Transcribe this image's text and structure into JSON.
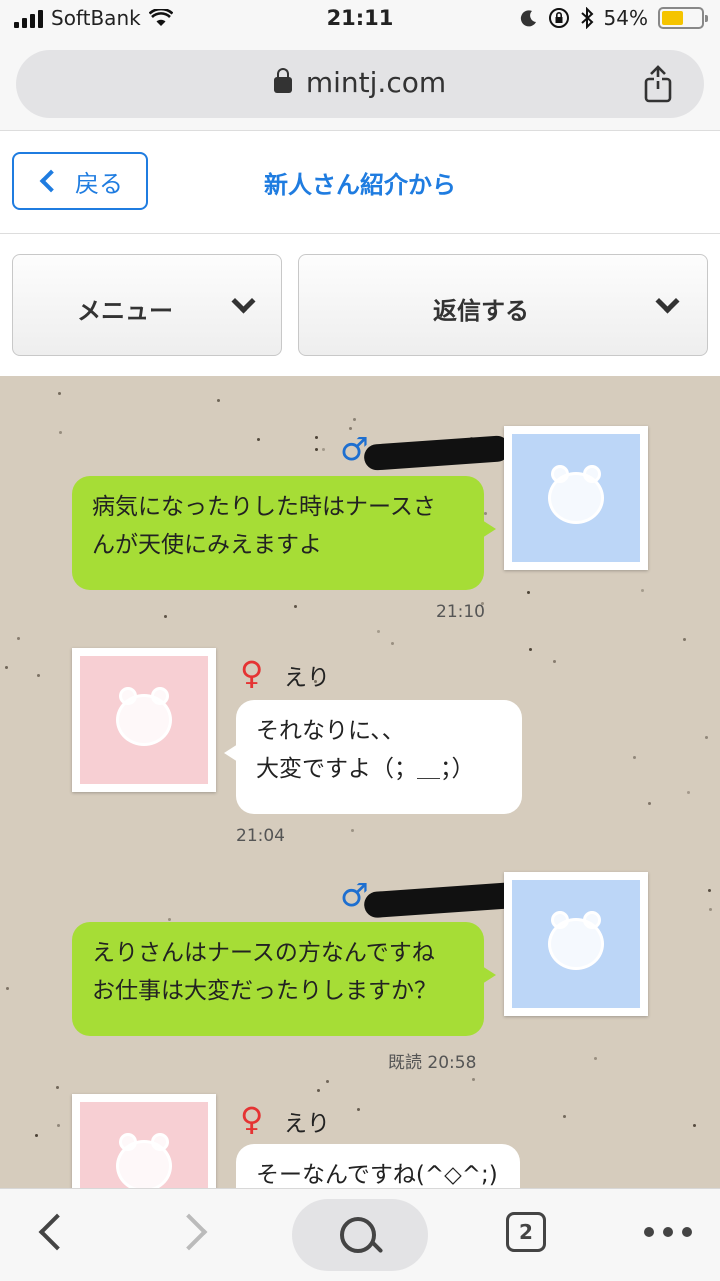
{
  "status_bar": {
    "carrier": "SoftBank",
    "time": "21:11",
    "battery": "54%",
    "battery_level": 0.54
  },
  "browser": {
    "url": "mintj.com"
  },
  "header": {
    "back_label": "戻る",
    "title": "新人さん紹介から"
  },
  "menu": {
    "menu_label": "メニュー",
    "reply_label": "返信する"
  },
  "messages": [
    {
      "side": "male",
      "text_lines": [
        "病気になったりした時はナースさ",
        "んが天使にみえますよ"
      ],
      "meta": "21:10"
    },
    {
      "side": "female",
      "name": "えり",
      "text_lines": [
        "それなりに、、",
        "大変ですよ（；＿；）"
      ],
      "meta": "21:04"
    },
    {
      "side": "male",
      "text_lines": [
        "えりさんはナースの方なんですね",
        "お仕事は大変だったりしますか？"
      ],
      "meta": "既読  20:58"
    },
    {
      "side": "female",
      "name": "えり",
      "text_lines": [
        "そーなんですね(^◇^;)"
      ],
      "meta": ""
    }
  ],
  "toolbar": {
    "tab_count": "2"
  },
  "symbols": {
    "male": "♂",
    "female": "♀"
  },
  "colors": {
    "accent": "#1f7ce0",
    "green_bubble": "#a6dd36",
    "chat_bg": "#d6ccbd"
  }
}
